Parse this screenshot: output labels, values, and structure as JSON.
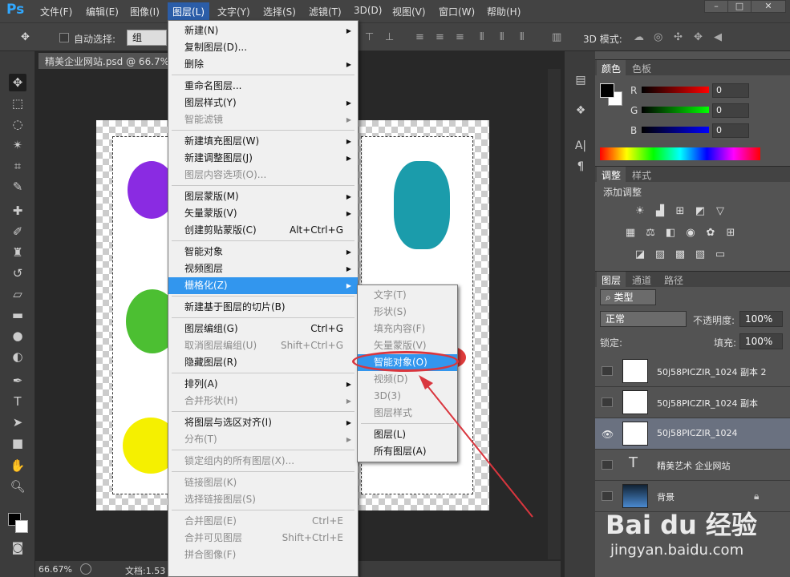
{
  "app": {
    "logo": "Ps"
  },
  "menubar": [
    "文件(F)",
    "编辑(E)",
    "图像(I)",
    "图层(L)",
    "文字(Y)",
    "选择(S)",
    "滤镜(T)",
    "3D(D)",
    "视图(V)",
    "窗口(W)",
    "帮助(H)"
  ],
  "window_controls": [
    "–",
    "□",
    "✕"
  ],
  "options_bar": {
    "auto_select_label": "自动选择:",
    "auto_select_value": "组",
    "mode_3d_label": "3D 模式:"
  },
  "document": {
    "tab": "精美企业网站.psd @ 66.7%"
  },
  "status": {
    "zoom": "66.67%",
    "doc_info": "文档:1.53"
  },
  "layer_menu": [
    {
      "label": "新建(N)",
      "arrow": true
    },
    {
      "label": "复制图层(D)..."
    },
    {
      "label": "删除",
      "arrow": true
    },
    {
      "sep": true
    },
    {
      "label": "重命名图层..."
    },
    {
      "label": "图层样式(Y)",
      "arrow": true
    },
    {
      "label": "智能滤镜",
      "arrow": true,
      "disabled": true
    },
    {
      "sep": true
    },
    {
      "label": "新建填充图层(W)",
      "arrow": true
    },
    {
      "label": "新建调整图层(J)",
      "arrow": true
    },
    {
      "label": "图层内容选项(O)...",
      "disabled": true
    },
    {
      "sep": true
    },
    {
      "label": "图层蒙版(M)",
      "arrow": true
    },
    {
      "label": "矢量蒙版(V)",
      "arrow": true
    },
    {
      "label": "创建剪贴蒙版(C)",
      "shortcut": "Alt+Ctrl+G"
    },
    {
      "sep": true
    },
    {
      "label": "智能对象",
      "arrow": true
    },
    {
      "label": "视频图层",
      "arrow": true
    },
    {
      "label": "栅格化(Z)",
      "arrow": true,
      "highlight": true
    },
    {
      "sep": true
    },
    {
      "label": "新建基于图层的切片(B)"
    },
    {
      "sep": true
    },
    {
      "label": "图层编组(G)",
      "shortcut": "Ctrl+G"
    },
    {
      "label": "取消图层编组(U)",
      "shortcut": "Shift+Ctrl+G",
      "disabled": true
    },
    {
      "label": "隐藏图层(R)"
    },
    {
      "sep": true
    },
    {
      "label": "排列(A)",
      "arrow": true
    },
    {
      "label": "合并形状(H)",
      "arrow": true,
      "disabled": true
    },
    {
      "sep": true
    },
    {
      "label": "将图层与选区对齐(I)",
      "arrow": true
    },
    {
      "label": "分布(T)",
      "arrow": true,
      "disabled": true
    },
    {
      "sep": true
    },
    {
      "label": "锁定组内的所有图层(X)...",
      "disabled": true
    },
    {
      "sep": true
    },
    {
      "label": "链接图层(K)",
      "disabled": true
    },
    {
      "label": "选择链接图层(S)",
      "disabled": true
    },
    {
      "sep": true
    },
    {
      "label": "合并图层(E)",
      "shortcut": "Ctrl+E",
      "disabled": true
    },
    {
      "label": "合并可见图层",
      "shortcut": "Shift+Ctrl+E",
      "disabled": true
    },
    {
      "label": "拼合图像(F)",
      "disabled": true
    }
  ],
  "rasterize_menu": [
    {
      "label": "文字(T)",
      "disabled": true
    },
    {
      "label": "形状(S)",
      "disabled": true
    },
    {
      "label": "填充内容(F)",
      "disabled": true
    },
    {
      "label": "矢量蒙版(V)",
      "disabled": true
    },
    {
      "label": "智能对象(O)",
      "highlight": true
    },
    {
      "label": "视频(D)",
      "disabled": true
    },
    {
      "label": "3D(3)",
      "disabled": true
    },
    {
      "label": "图层样式",
      "disabled": true
    },
    {
      "sep": true
    },
    {
      "label": "图层(L)"
    },
    {
      "label": "所有图层(A)"
    }
  ],
  "color_panel": {
    "tabs": [
      "颜色",
      "色板"
    ],
    "r_label": "R",
    "g_label": "G",
    "b_label": "B",
    "r": "0",
    "g": "0",
    "b": "0"
  },
  "adjust_panel": {
    "tabs": [
      "调整",
      "样式"
    ],
    "title": "添加调整"
  },
  "layers_panel": {
    "tabs": [
      "图层",
      "通道",
      "路径"
    ],
    "filter": "类型",
    "blend": "正常",
    "opacity_label": "不透明度:",
    "opacity": "100%",
    "lock_label": "锁定:",
    "fill_label": "填充:",
    "fill": "100%",
    "layers": [
      {
        "name": "50j58PICZIR_1024 副本 2",
        "kind": "image"
      },
      {
        "name": "50j58PICZIR_1024 副本",
        "kind": "image"
      },
      {
        "name": "50j58PICZIR_1024",
        "kind": "image",
        "selected": true,
        "visible": true
      },
      {
        "name": "精美艺术 企业网站",
        "kind": "text"
      },
      {
        "name": "背景",
        "kind": "bg",
        "locked": true
      }
    ]
  },
  "watermark": {
    "brand": "Bai du 经验",
    "url": "jingyan.baidu.com"
  },
  "colors": {
    "menu_highlight": "#3296ee",
    "annotation": "#d9363e"
  }
}
